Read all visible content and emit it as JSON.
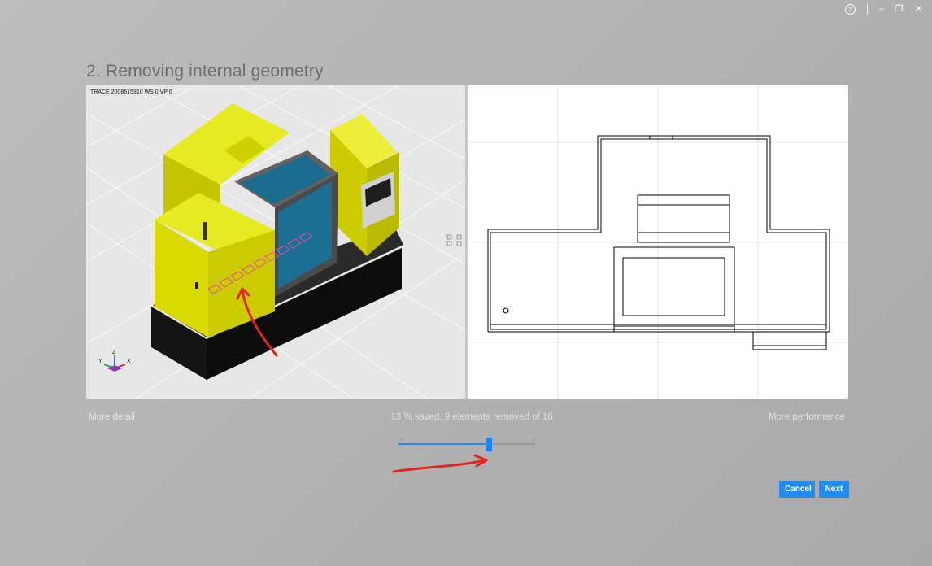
{
  "window": {
    "help_glyph": "?",
    "minimize_glyph": "–",
    "restore_glyph": "❐",
    "close_glyph": "✕"
  },
  "step_title": "2. Removing internal geometry",
  "viewport_3d": {
    "trace_text": "TRACE 2008615310  WS 0  VP 0",
    "axes": {
      "x": "X",
      "y": "Y",
      "z": "Z"
    }
  },
  "slider": {
    "left_label": "More detail",
    "right_label": "More performance",
    "status_text": "13 % saved, 9 elements removed of 16",
    "value_fraction": 0.66,
    "tick_fractions": [
      0.02,
      0.34,
      0.66,
      0.98
    ]
  },
  "buttons": {
    "cancel_label": "Cancel",
    "next_label": "Next"
  },
  "colors": {
    "accent": "#1e8cf4",
    "machine_yellow": "#d7d900",
    "machine_window": "#1d6e91",
    "machine_base": "#151515",
    "annotation_red": "#e0271f"
  },
  "icons": [
    "help-icon",
    "minimize-icon",
    "restore-icon",
    "close-icon",
    "axis-triad-icon",
    "view-toggle-icon"
  ]
}
